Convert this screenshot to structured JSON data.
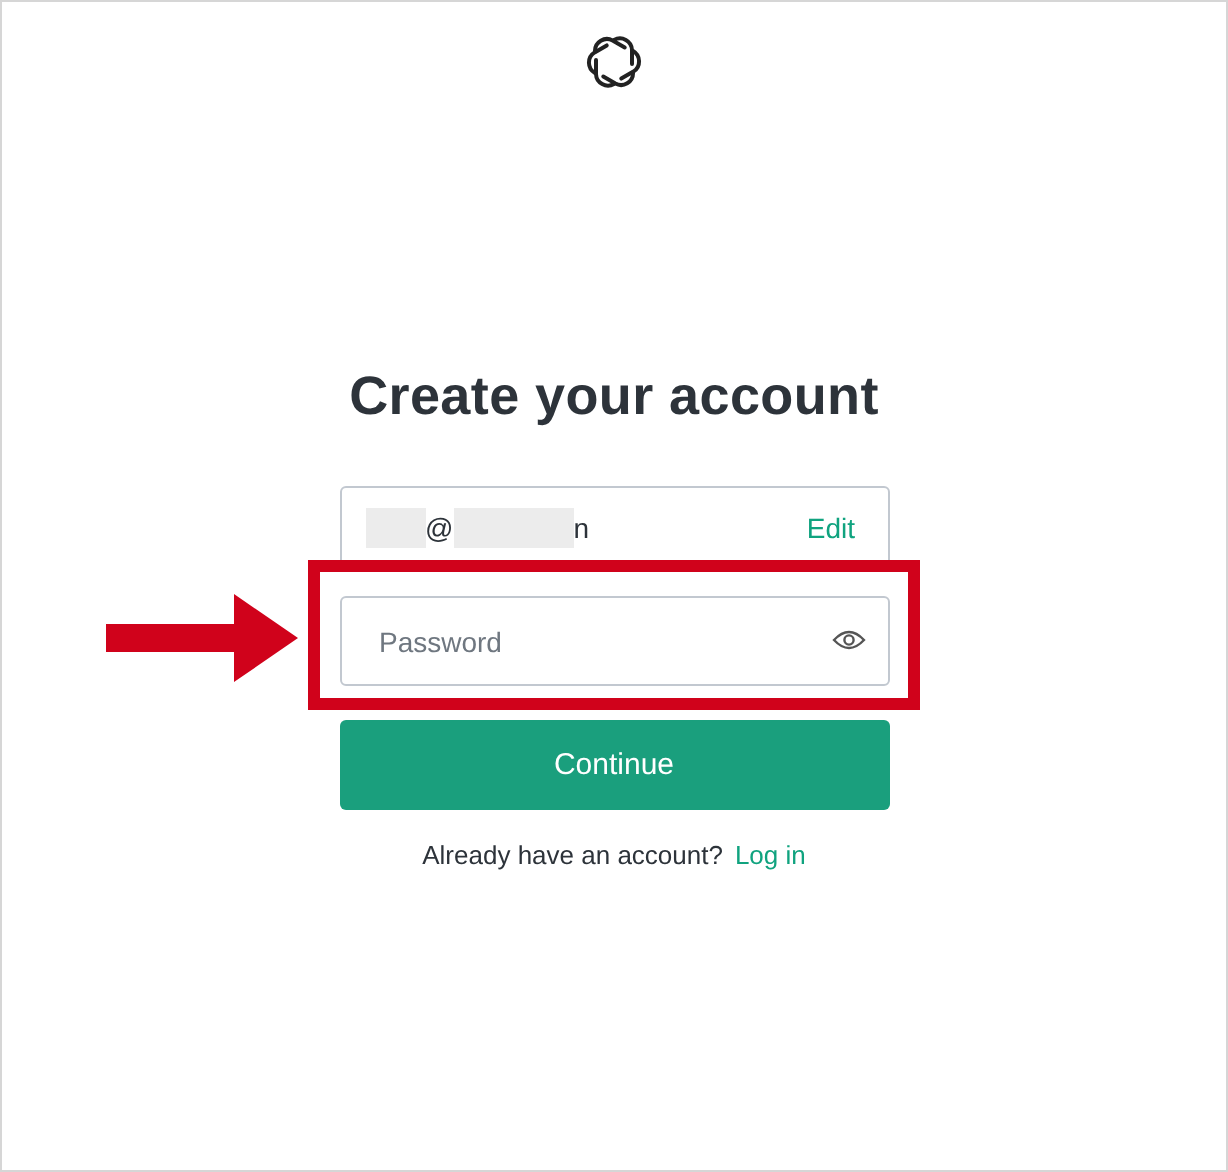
{
  "heading": "Create your account",
  "email": {
    "parts": [
      "@",
      "n"
    ],
    "redacted": true,
    "action": "Edit"
  },
  "password": {
    "placeholder": "Password",
    "highlighted": true
  },
  "continue_button": "Continue",
  "login_prompt": {
    "text": "Already have an account?",
    "link": "Log in"
  }
}
